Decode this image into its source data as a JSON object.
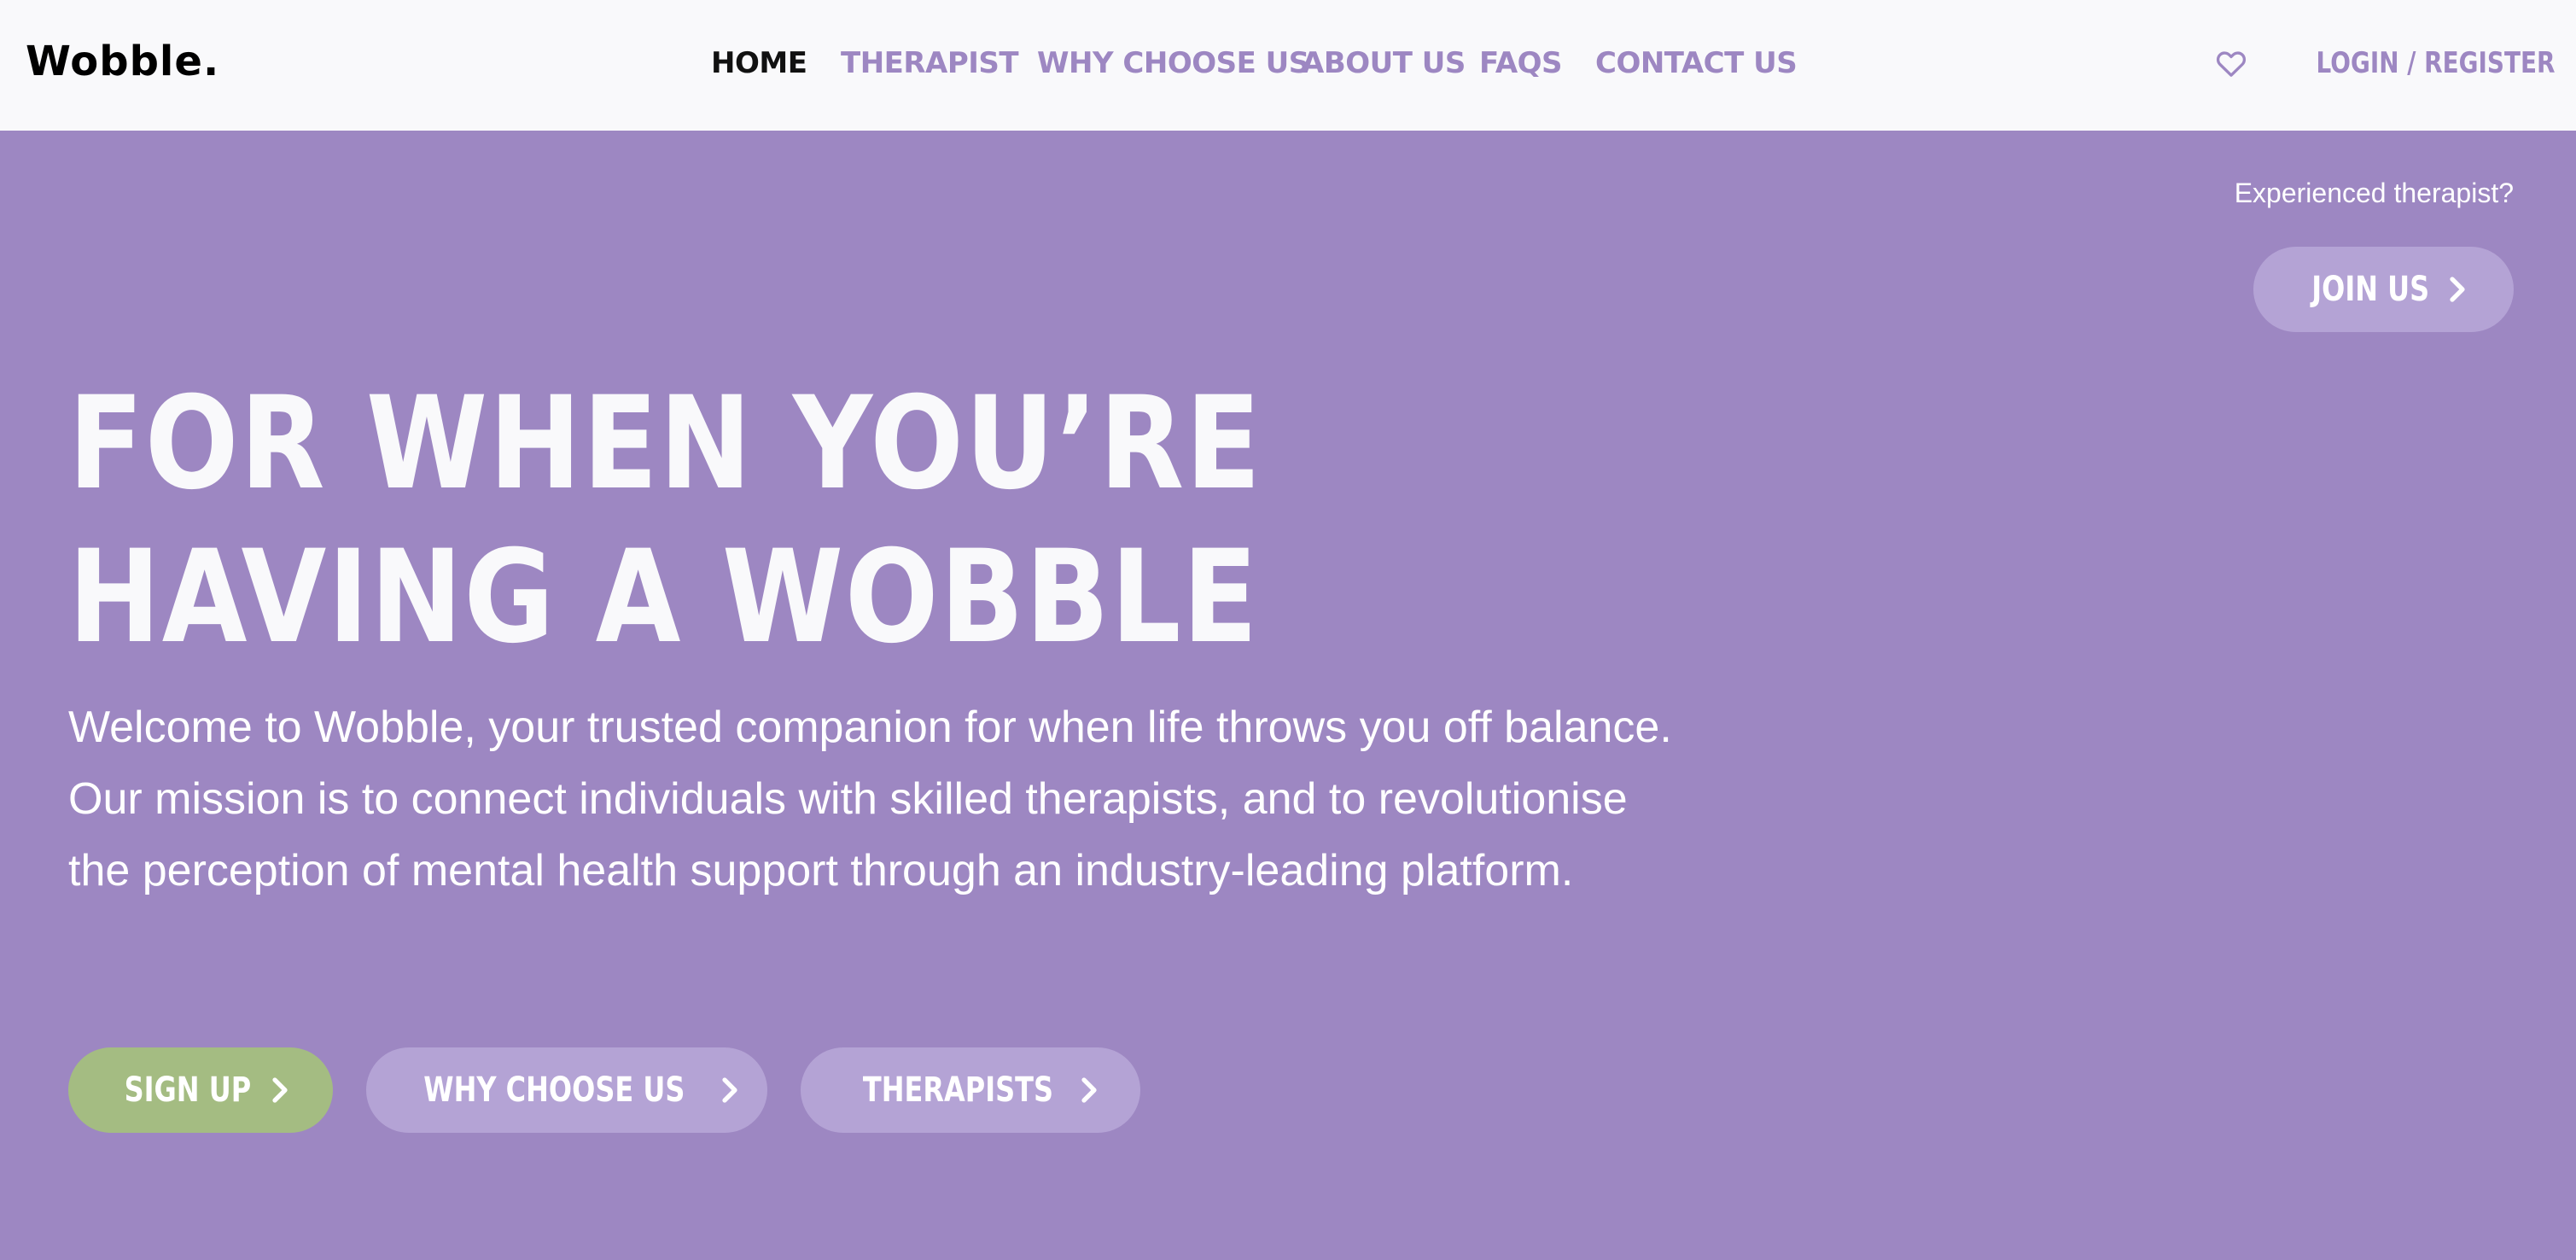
{
  "header": {
    "logo": "Wobble.",
    "nav": [
      {
        "label": "HOME",
        "active": true
      },
      {
        "label": "THERAPIST",
        "active": false
      },
      {
        "label": "WHY CHOOSE US",
        "active": false
      },
      {
        "label": "ABOUT US",
        "active": false
      },
      {
        "label": "FAQS",
        "active": false
      },
      {
        "label": "CONTACT US",
        "active": false
      }
    ],
    "login_label": "LOGIN / REGISTER",
    "login_icon": "heart-icon"
  },
  "therapist_cta": {
    "prompt": "Experienced therapist?",
    "button_label": "JOIN US"
  },
  "hero": {
    "title": "FOR WHEN YOU’RE HAVING A WOBBLE",
    "body": "Welcome to Wobble, your trusted companion for when life throws you off balance. Our mission is to connect individuals with skilled therapists, and to revolutionise the perception of mental health support through an industry-leading platform.",
    "buttons": {
      "signup": "SIGN UP",
      "why": "WHY CHOOSE US",
      "therapists": "THERAPISTS"
    }
  },
  "colors": {
    "brand_purple": "#9d87c2",
    "pill_purple": "#b4a3d5",
    "pill_green": "#a4bc82",
    "header_bg": "#f9f9fb"
  }
}
